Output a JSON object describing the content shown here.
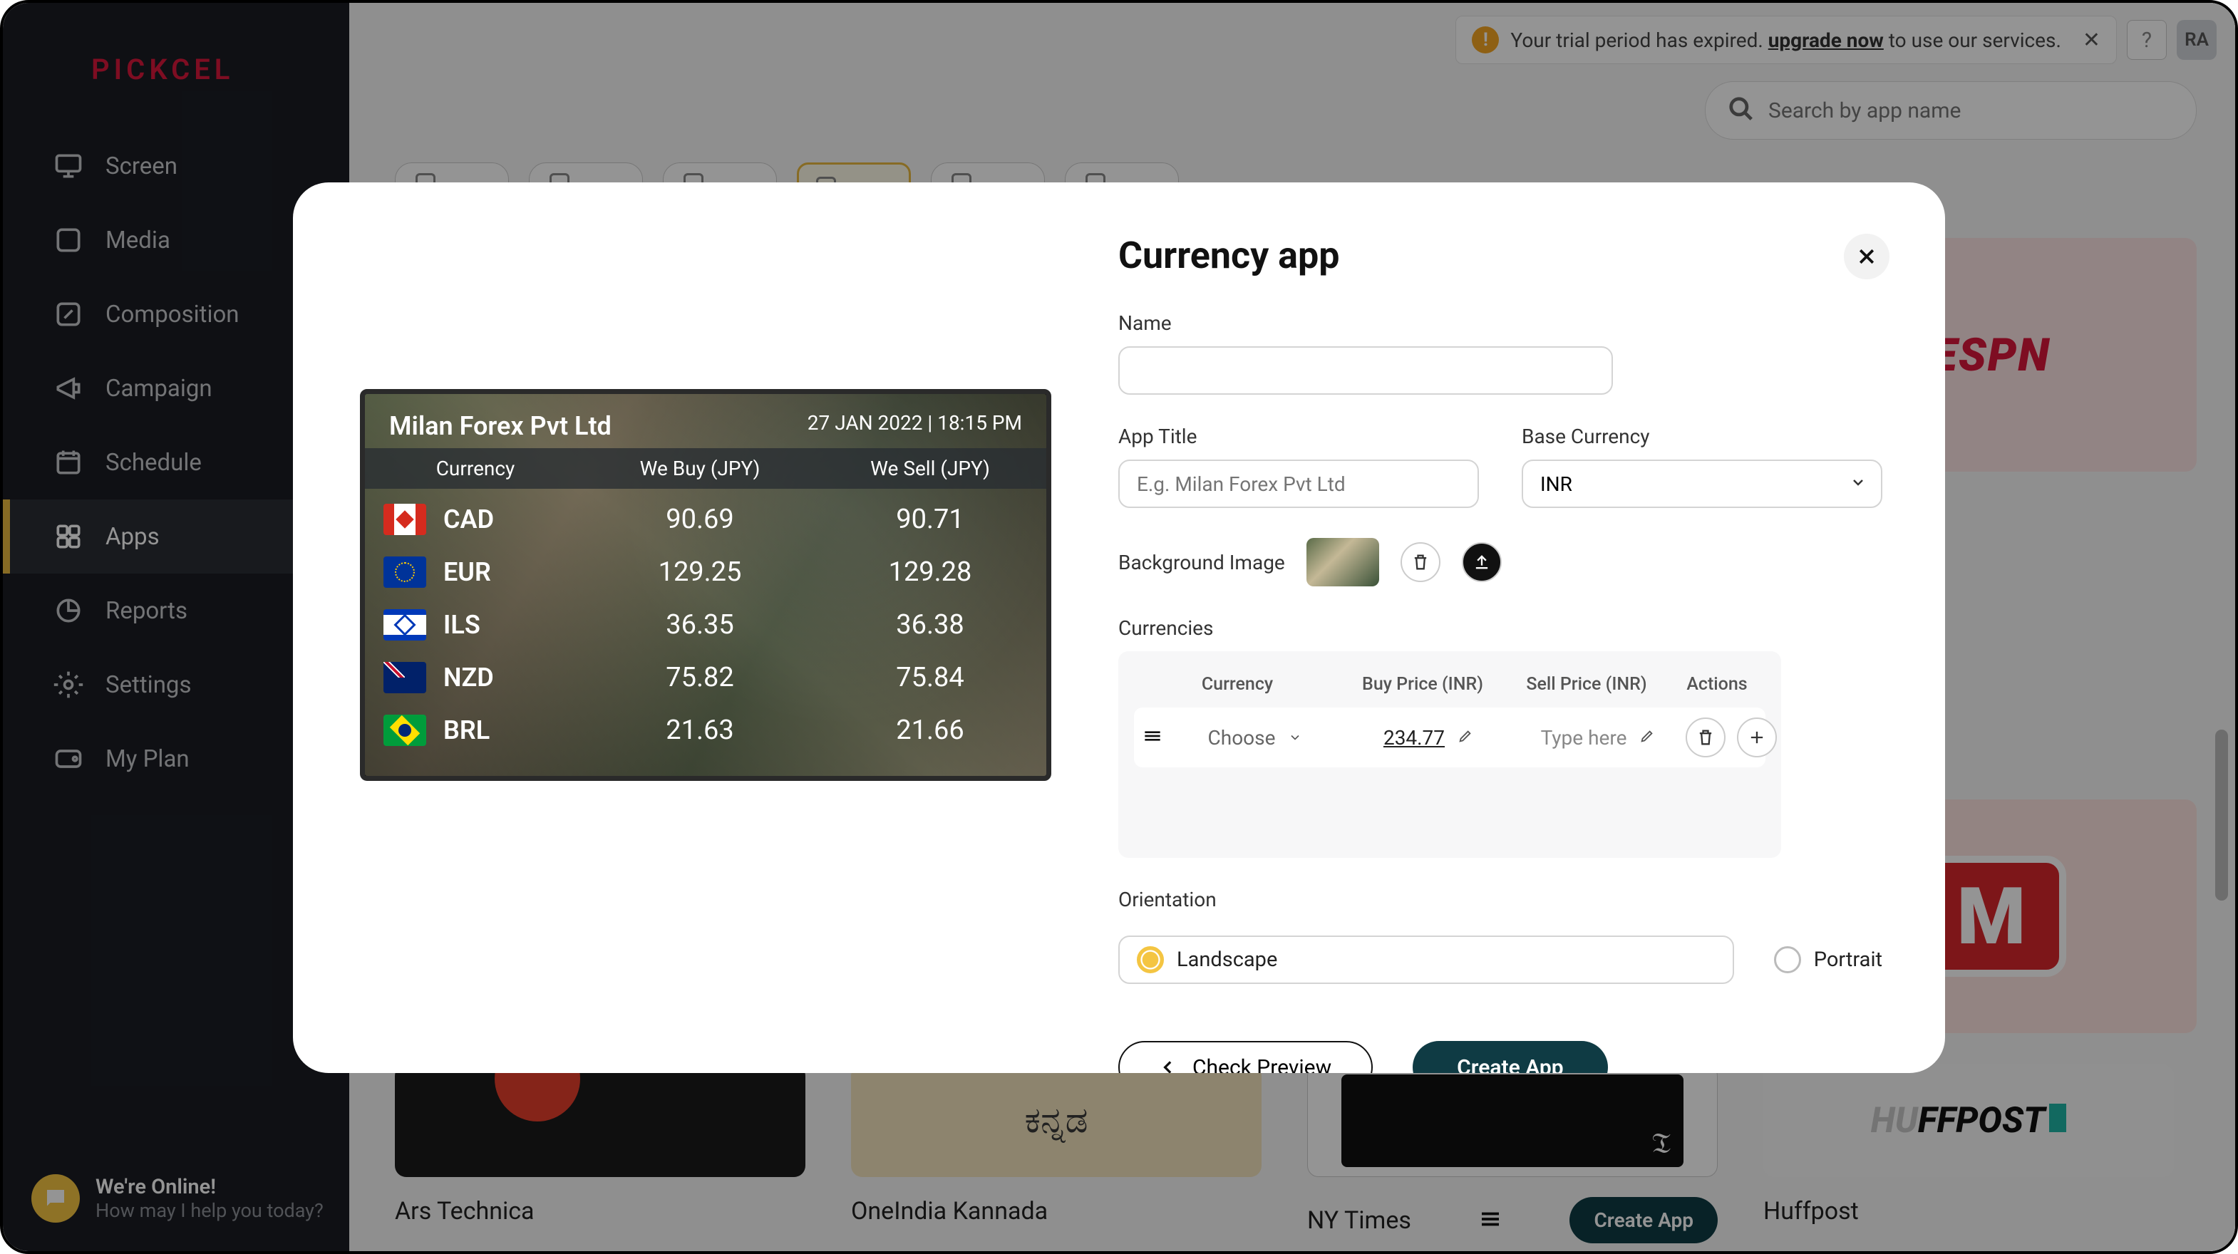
{
  "logo": "PICKCEL",
  "nav": {
    "items": [
      "Screen",
      "Media",
      "Composition",
      "Campaign",
      "Schedule",
      "Apps",
      "Reports",
      "Settings",
      "My Plan"
    ]
  },
  "chat": {
    "l1": "We're Online!",
    "l2": "How may I help you today?"
  },
  "topbar": {
    "trial_text": "Your trial period has expired.",
    "upgrade": "upgrade now",
    "trial_suffix": " to use our services.",
    "avatar": "RA"
  },
  "search": {
    "placeholder": "Search by app name"
  },
  "cards": {
    "c1": "Ars Technica",
    "c2": "OneIndia Kannada",
    "c2_glyph": "ಕನ್ನಡ",
    "c3": "NY Times",
    "c4": "Huffpost",
    "create": "Create App"
  },
  "espn": "ESPN",
  "modal": {
    "title": "Currency app",
    "name_label": "Name",
    "apptitle_label": "App Title",
    "apptitle_ph": "E.g. Milan Forex Pvt Ltd",
    "basecurr_label": "Base Currency",
    "basecurr_val": "INR",
    "bgimg_label": "Background Image",
    "currencies_label": "Currencies",
    "hdr": {
      "c1": "Currency",
      "c2": "Buy Price (INR)",
      "c3": "Sell Price (INR)",
      "c4": "Actions"
    },
    "row": {
      "choose": "Choose",
      "buy": "234.77",
      "sell_ph": "Type here"
    },
    "orient_label": "Orientation",
    "landscape": "Landscape",
    "portrait": "Portrait",
    "preview_btn": "Check Preview",
    "create_btn": "Create App"
  },
  "preview": {
    "title": "Milan Forex Pvt Ltd",
    "date": "27 JAN 2022 | 18:15 PM",
    "hdr": {
      "c": "Currency",
      "b": "We Buy (JPY)",
      "s": "We Sell (JPY)"
    }
  },
  "chart_data": {
    "type": "table",
    "title": "Milan Forex Pvt Ltd",
    "timestamp": "27 JAN 2022 | 18:15 PM",
    "columns": [
      "Currency",
      "We Buy (JPY)",
      "We Sell (JPY)"
    ],
    "rows": [
      {
        "code": "CAD",
        "buy": 90.69,
        "sell": 90.71
      },
      {
        "code": "EUR",
        "buy": 129.25,
        "sell": 129.28
      },
      {
        "code": "ILS",
        "buy": 36.35,
        "sell": 36.38
      },
      {
        "code": "NZD",
        "buy": 75.82,
        "sell": 75.84
      },
      {
        "code": "BRL",
        "buy": 21.63,
        "sell": 21.66
      }
    ]
  }
}
